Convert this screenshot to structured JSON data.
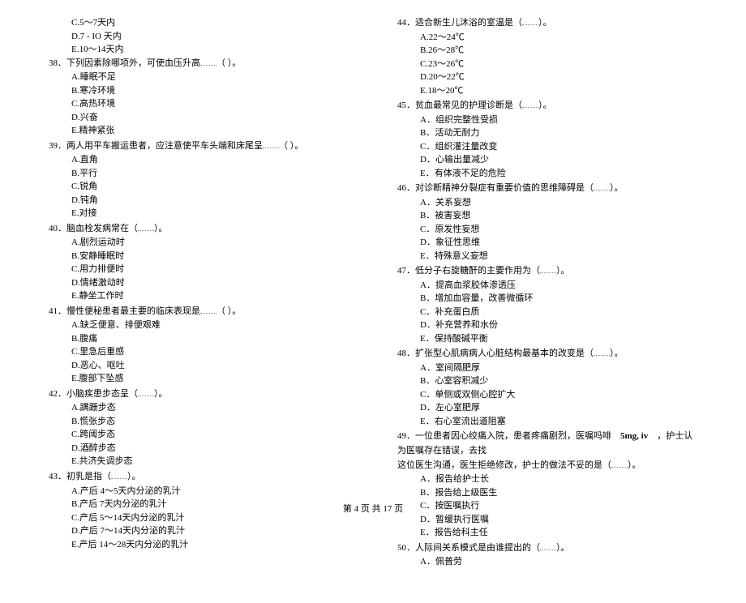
{
  "left_column": {
    "q37_options": [
      "C.5～7天内",
      "D.7 - IO    天内",
      "E.10～14天内"
    ],
    "questions": [
      {
        "num": "38",
        "text": "．下列因素除哪项外，可使血压升高",
        "blank": true,
        "suffix": "（         ）。",
        "options": [
          "A.睡眠不足",
          "B.寒冷环境",
          "C.高热环境",
          "D.兴奋",
          "E.精神紧张"
        ]
      },
      {
        "num": "39",
        "text": "．两人用平车搬运患者，应注意使平车头端和床尾呈",
        "blank": true,
        "suffix": "（         ）。",
        "options": [
          "A.直角",
          "B.平行",
          "C.锐角",
          "D.钝角",
          "E.对接"
        ]
      },
      {
        "num": "40",
        "text": "．脑血栓发病常在（",
        "blank": true,
        "suffix": "）。",
        "options": [
          "A.剧烈运动时",
          "B.安静睡眠时",
          "C.用力排便时",
          "D.情绪激动时",
          "E.静坐工作时"
        ]
      },
      {
        "num": "41",
        "text": "．慢性便秘患者最主要的临床表现是",
        "blank": true,
        "suffix": "（         ）。",
        "options": [
          "A.缺乏便意、排便艰难",
          "B.腹痛",
          "C.里急后重感",
          "D.恶心、呕吐",
          "E.腹部下坠感"
        ]
      },
      {
        "num": "42",
        "text": "．小脑疾患步态呈（",
        "blank": true,
        "suffix": "）。",
        "options": [
          "A.蹒跚步态",
          "B.慌张步态",
          "C.跨阈步态",
          "D.酒醉步态",
          "E.共济失调步态"
        ]
      },
      {
        "num": "43",
        "text": "．初乳是指（",
        "blank": true,
        "suffix": "）。",
        "options": [
          "A.产后 4～5天内分泌的乳汁",
          "B.产后 7天内分泌的乳汁",
          "C.产后 5～14天内分泌的乳汁",
          "D.产后 7～14天内分泌的乳汁",
          "E.产后 14～28天内分泌的乳汁"
        ]
      }
    ]
  },
  "right_column": {
    "questions": [
      {
        "num": "44",
        "text": "．适合新生儿沐浴的室温是（",
        "blank": true,
        "suffix": "）。",
        "options": [
          "A.22～24℃",
          "B.26～28℃",
          "C.23～26℃",
          "D.20～22℃",
          "E.18～20℃"
        ]
      },
      {
        "num": "45",
        "text": "．贫血最常见的护理诊断是（",
        "blank": true,
        "suffix": "）。",
        "options": [
          "A．组织完整性受损",
          "B．活动无耐力",
          "C．组织灌注量改变",
          "D．心输出量减少",
          "E．有体液不足的危险"
        ]
      },
      {
        "num": "46",
        "text": "．对诊断精神分裂症有重要价值的思维障碍是（",
        "blank": true,
        "suffix": "）。",
        "options": [
          "A．关系妄想",
          "B．被害妄想",
          "C．原发性妄想",
          "D．象征性思维",
          "E．特殊意义妄想"
        ]
      },
      {
        "num": "47",
        "text": "．低分子右旋糖酐的主要作用为（",
        "blank": true,
        "suffix": "）。",
        "options": [
          "A．提高血浆胶体渗透压",
          "B．增加血容量，改善微循环",
          "C．补充蛋白质",
          "D．补充营养和水份",
          "E．保持酸碱平衡"
        ]
      },
      {
        "num": "48",
        "text": "．扩张型心肌病病人心脏结构最基本的改变是（",
        "blank": true,
        "suffix": "）。",
        "options": [
          "A．室间隔肥厚",
          "B．心室容积减少",
          "C．单侧或双侧心腔扩大",
          "D．左心室肥厚",
          "E．右心室流出道阻塞"
        ]
      },
      {
        "num": "49",
        "text": "．",
        "long_text_1": "一位患者因心绞痛入院，患者疼痛剧烈，医嘱吗啡",
        "bold_text": "5mg, iv",
        "long_text_2": "，护士认为医嘱存在错误，去找",
        "long_text_3": "这位医生沟通，医生拒绝修改，护士的做法不妥的是（",
        "blank": true,
        "suffix": "）。",
        "options": [
          "A．报告给护士长",
          "B．报告给上级医生",
          "C．按医嘱执行",
          "D．暂缓执行医嘱",
          "E．报告给科主任"
        ]
      },
      {
        "num": "50",
        "text": "．人际间关系模式是由谁提出的（",
        "blank": true,
        "suffix": "）。",
        "options": [
          "A．佩普劳"
        ]
      }
    ]
  },
  "footer": {
    "text": "第  4 页  共  17 页"
  }
}
